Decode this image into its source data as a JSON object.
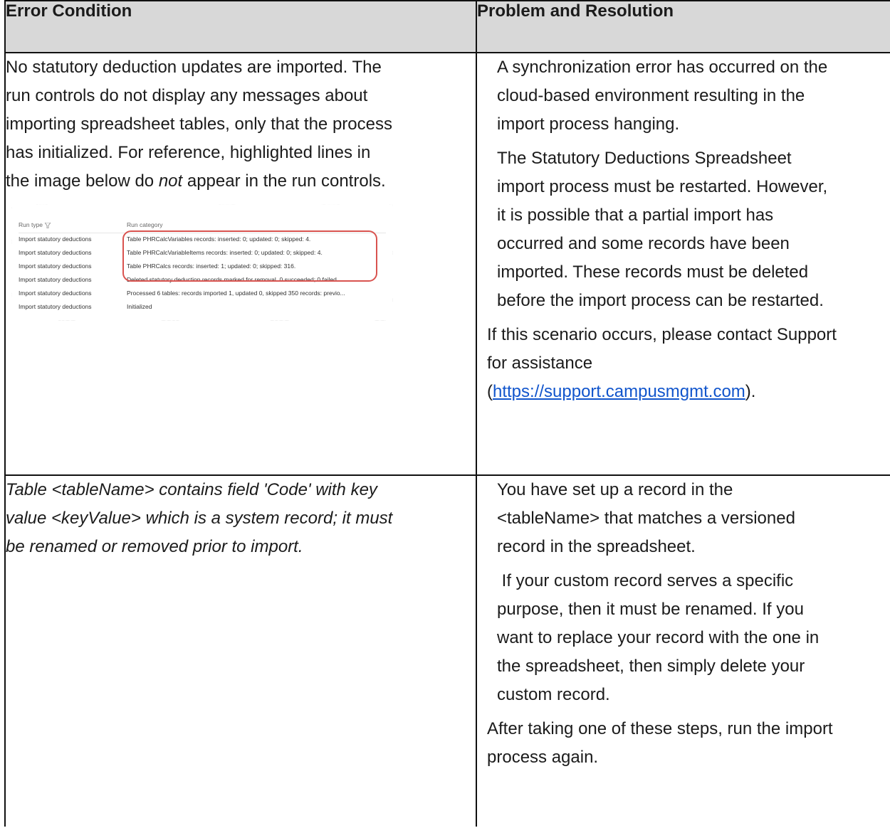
{
  "header": {
    "col1": "Error Condition",
    "col2": "Problem and Resolution"
  },
  "row1": {
    "left_lines": [
      "No statutory deduction updates are imported. The",
      "run controls do not display any messages about",
      "importing spreadsheet tables, only that the process",
      "has initialized. For reference, highlighted lines in"
    ],
    "left_last_pre": "the image below do ",
    "left_last_em": "not",
    "left_last_post": " appear in the run controls.",
    "right_lines": [
      "A synchronization error has occurred on the",
      "cloud-based environment resulting in the",
      "import process hanging."
    ],
    "right_lines2": [
      "The Statutory Deductions Spreadsheet",
      "import process must be restarted. However,",
      "it is possible that a partial import has",
      "occurred and some records have been",
      "imported. These records must be deleted",
      "before the import process can be restarted."
    ],
    "contact_1": "If this scenario occurs, please contact Support",
    "contact_2": "for assistance",
    "open_paren": "(",
    "link": "https://support.campusmgmt.com",
    "close_paren": ")."
  },
  "screenshot": {
    "col_run_type": "Run type",
    "col_run_category": "Run category",
    "rows": [
      {
        "type": "Import statutory deductions",
        "category": "Table PHRCalcVariables records: inserted: 0; updated: 0; skipped: 4."
      },
      {
        "type": "Import statutory deductions",
        "category": "Table PHRCalcVariableItems records: inserted: 0; updated: 0; skipped: 4."
      },
      {
        "type": "Import statutory deductions",
        "category": "Table PHRCalcs records: inserted: 1; updated: 0; skipped: 316."
      },
      {
        "type": "Import statutory deductions",
        "category": "Deleted statutory deduction records marked for removal. 0 succeeded; 0 failed..."
      },
      {
        "type": "Import statutory deductions",
        "category": "Processed 6 tables: records imported 1, updated 0, skipped 350 records: previo..."
      },
      {
        "type": "Import statutory deductions",
        "category": "Initialized"
      }
    ],
    "highlight_color": "#d9534f"
  },
  "row2": {
    "left_lines": [
      "Table <tableName> contains field 'Code' with key",
      "value <keyValue> which is a system record; it must",
      "be renamed or removed prior to import."
    ],
    "right_lines": [
      "You have set up a record in the",
      "<tableName> that matches a versioned",
      "record in the spreadsheet."
    ],
    "right_lines2": [
      " If your custom record serves a specific",
      "purpose, then it must be renamed. If you",
      "want to replace your record with the one in",
      "the spreadsheet, then simply delete your",
      "custom record."
    ],
    "after_1": "After taking one of these steps, run the import",
    "after_2": "process again."
  }
}
